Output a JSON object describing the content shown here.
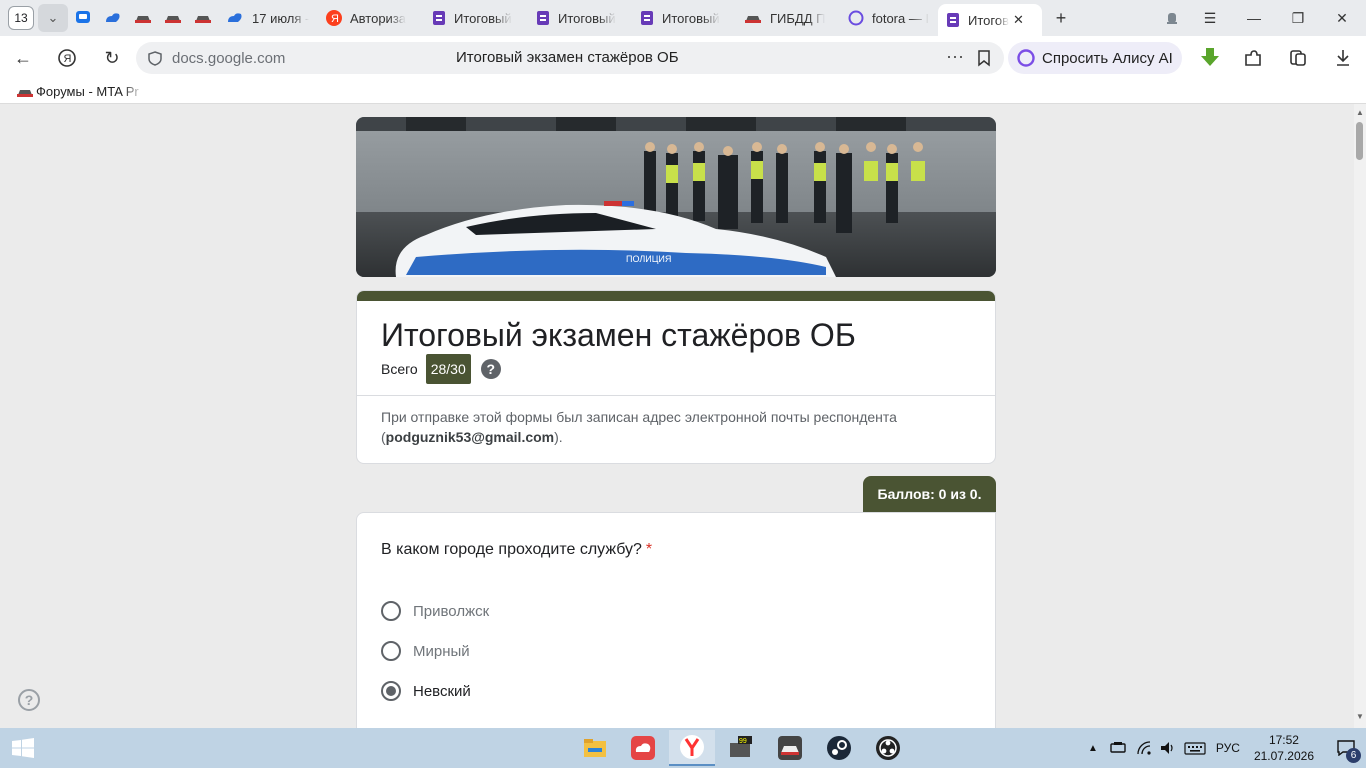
{
  "browser": {
    "tab_count": "13",
    "tabs": [
      {
        "title": "17 июля -",
        "icon": "cloud-icon"
      },
      {
        "title": "Авториза",
        "icon": "yandex-icon"
      },
      {
        "title": "Итоговый",
        "icon": "google-forms-icon"
      },
      {
        "title": "Итоговый",
        "icon": "google-forms-icon"
      },
      {
        "title": "Итоговый",
        "icon": "google-forms-icon"
      },
      {
        "title": "ГИБДД П",
        "icon": "car-icon"
      },
      {
        "title": "fotora — I",
        "icon": "alice-icon"
      },
      {
        "title": "Итогов",
        "icon": "google-forms-icon",
        "active": true
      }
    ],
    "address": {
      "domain": "docs.google.com",
      "page_title": "Итоговый экзамен стажёров ОБ"
    },
    "alice_label": "Спросить Алису AI",
    "bookmarks": [
      {
        "label": "Форумы - MTA Pr"
      }
    ]
  },
  "form": {
    "title": "Итоговый экзамен стажёров ОБ",
    "total_label": "Всего",
    "score": "28/30",
    "email_note_prefix": "При отправке этой формы был записан адрес электронной почты респондента (",
    "email": "podguznik53@gmail.com",
    "email_note_suffix": ").",
    "points_badge": "Баллов: 0 из 0.",
    "question": {
      "text": "В каком городе проходите службу?",
      "required_mark": "*",
      "options": [
        {
          "label": "Приволжск",
          "selected": false
        },
        {
          "label": "Мирный",
          "selected": false
        },
        {
          "label": "Невский",
          "selected": true
        }
      ]
    }
  },
  "taskbar": {
    "language": "РУС",
    "time": "17:52",
    "date": "21.07.2026",
    "notifications": "6"
  },
  "colors": {
    "accent": "#4a5433",
    "required": "#d93025"
  }
}
